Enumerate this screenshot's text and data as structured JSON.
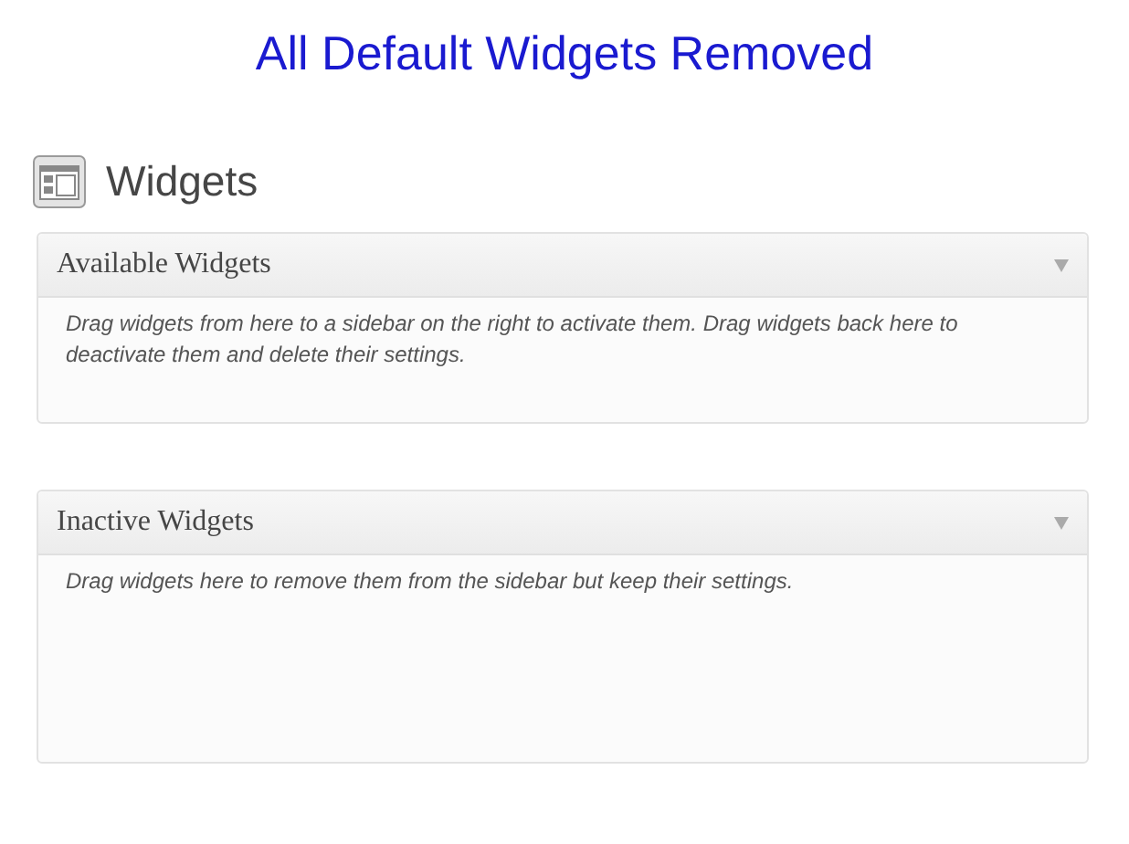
{
  "banner": {
    "title": "All Default Widgets Removed"
  },
  "page": {
    "title": "Widgets"
  },
  "panels": [
    {
      "title": "Available Widgets",
      "description": "Drag widgets from here to a sidebar on the right to activate them. Drag widgets back here to deactivate them and delete their settings.",
      "expanded": true
    },
    {
      "title": "Inactive Widgets",
      "description": "Drag widgets here to remove them from the sidebar but keep their settings.",
      "expanded": true
    }
  ]
}
